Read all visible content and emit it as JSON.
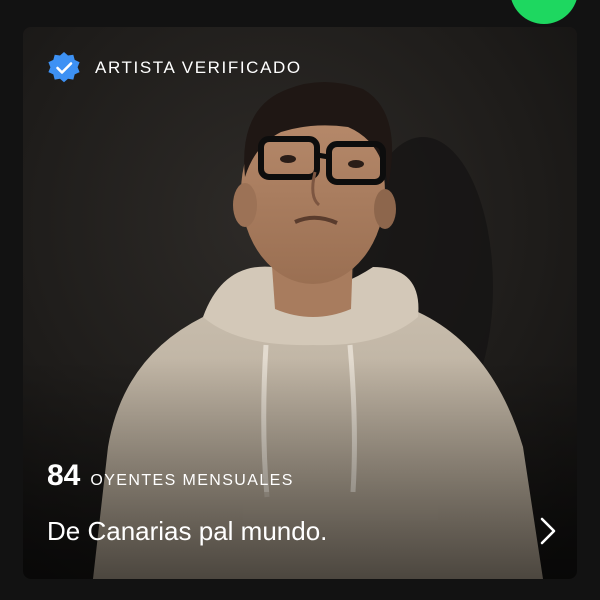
{
  "colors": {
    "accent_green": "#1ed760",
    "verified_blue": "#3d91f4",
    "text": "#ffffff",
    "background": "#121212"
  },
  "artist_card": {
    "verified_label": "ARTISTA VERIFICADO",
    "verified_icon": "verified-badge-icon",
    "monthly_listeners_count": "84",
    "monthly_listeners_label": "OYENTES MENSUALES",
    "bio": "De Canarias pal mundo.",
    "bio_action_icon": "chevron-right-icon"
  }
}
